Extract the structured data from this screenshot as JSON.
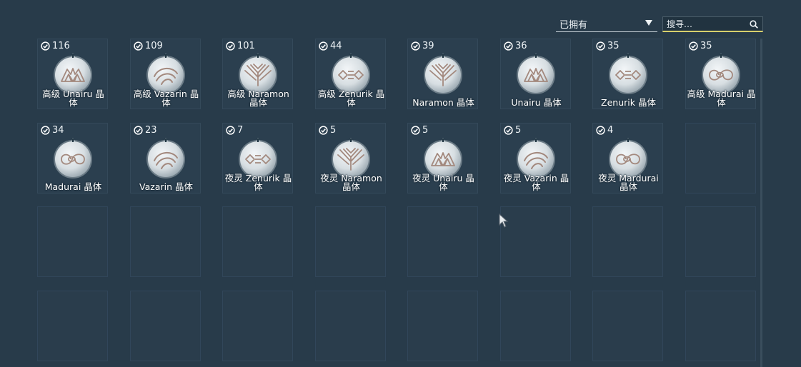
{
  "filter": {
    "selected": "已拥有"
  },
  "search": {
    "placeholder": "搜寻…"
  },
  "items": [
    {
      "count": "116",
      "name": "高级 Unairu 晶体",
      "icon": "unairu-sigil-icon",
      "lines": 2
    },
    {
      "count": "109",
      "name": "高级 Vazarin 晶体",
      "icon": "vazarin-sigil-icon",
      "lines": 2
    },
    {
      "count": "101",
      "name": "高级 Naramon 晶体",
      "icon": "naramon-sigil-icon",
      "lines": 2
    },
    {
      "count": "44",
      "name": "高级 Zenurik 晶体",
      "icon": "zenurik-sigil-icon",
      "lines": 2
    },
    {
      "count": "39",
      "name": "Naramon 晶体",
      "icon": "naramon-sigil-icon",
      "lines": 1
    },
    {
      "count": "36",
      "name": "Unairu 晶体",
      "icon": "unairu-sigil-icon",
      "lines": 1
    },
    {
      "count": "35",
      "name": "Zenurik 晶体",
      "icon": "zenurik-sigil-icon",
      "lines": 1
    },
    {
      "count": "35",
      "name": "高级 Madurai 晶体",
      "icon": "madurai-sigil-icon",
      "lines": 2
    },
    {
      "count": "34",
      "name": "Madurai 晶体",
      "icon": "madurai-sigil-icon",
      "lines": 1
    },
    {
      "count": "23",
      "name": "Vazarin 晶体",
      "icon": "vazarin-sigil-icon",
      "lines": 1
    },
    {
      "count": "7",
      "name": "夜灵 Zenurik 晶体",
      "icon": "zenurik-sigil-icon",
      "lines": 2
    },
    {
      "count": "5",
      "name": "夜灵 Naramon 晶体",
      "icon": "naramon-sigil-icon",
      "lines": 2
    },
    {
      "count": "5",
      "name": "夜灵 Unairu 晶体",
      "icon": "unairu-sigil-icon",
      "lines": 2
    },
    {
      "count": "5",
      "name": "夜灵 Vazarin 晶体",
      "icon": "vazarin-sigil-icon",
      "lines": 2
    },
    {
      "count": "4",
      "name": "夜灵 Mardurai 晶体",
      "icon": "madurai-sigil-icon",
      "lines": 2
    }
  ],
  "total_slots": 32,
  "colors": {
    "background": "#283b4a",
    "search_underline": "#d7cf6c",
    "sigil": "#a3897e"
  }
}
